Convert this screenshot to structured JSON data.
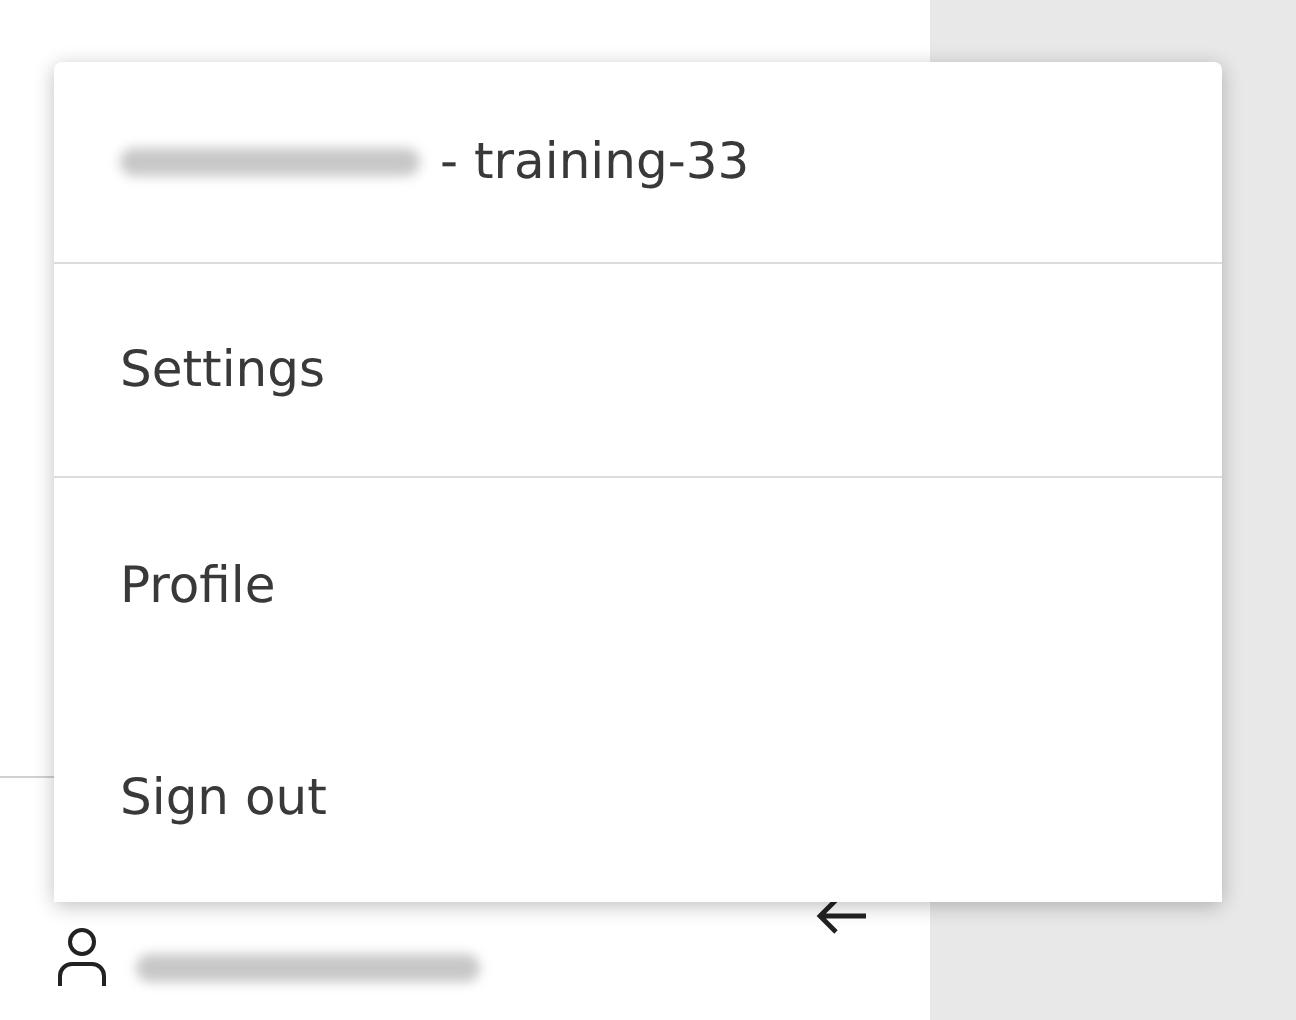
{
  "menu": {
    "header": {
      "text": "- training-33"
    },
    "items": [
      {
        "label": "Settings",
        "divider_after": true
      },
      {
        "label": "Profile",
        "divider_after": false
      },
      {
        "label": "Sign out",
        "divider_after": false
      }
    ]
  }
}
